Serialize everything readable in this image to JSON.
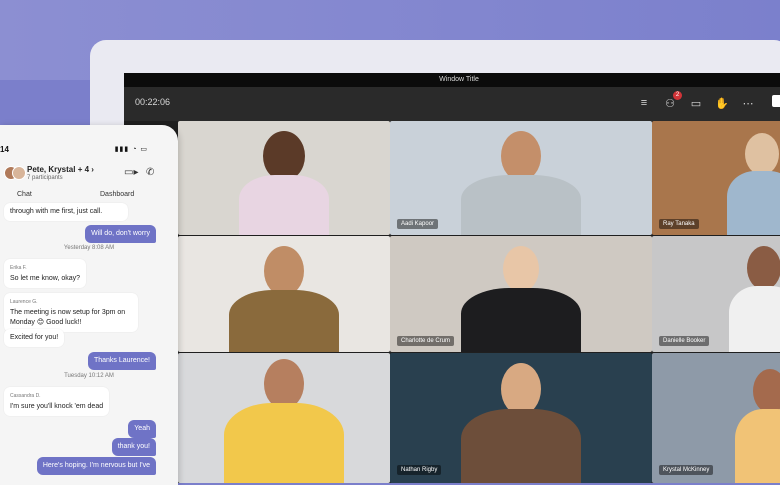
{
  "window": {
    "title": "Window Title"
  },
  "meeting": {
    "timer": "00:22:06",
    "toolbar_icons": [
      "list-icon",
      "participants-icon",
      "chat-icon",
      "raise-hand-icon",
      "more-icon"
    ],
    "participants_badge": "2",
    "tiles": [
      {
        "name": "",
        "bg": "#d9d6d0",
        "skin": "#5b3a28",
        "shirt": "#e8d5e2"
      },
      {
        "name": "Aadi Kapoor",
        "bg": "#c9d1d9",
        "skin": "#c48f6a",
        "shirt": "#b9c1c6"
      },
      {
        "name": "Ray Tanaka",
        "bg": "#a9764c",
        "skin": "#dfc1a1",
        "shirt": "#9fb7cd"
      },
      {
        "name": "",
        "bg": "#e9e6e2",
        "skin": "#c08d66",
        "shirt": "#8a6a3c"
      },
      {
        "name": "Charlotte de Crum",
        "bg": "#cfc9c2",
        "skin": "#e8c6a7",
        "shirt": "#1d1d1f"
      },
      {
        "name": "Danielle Booker",
        "bg": "#c7c7c8",
        "skin": "#8a5c44",
        "shirt": "#f0f0f0"
      },
      {
        "name": "",
        "bg": "#d8d9db",
        "skin": "#b67f5f",
        "shirt": "#f2c84b"
      },
      {
        "name": "Nathan Rigby",
        "bg": "#29404f",
        "skin": "#d8a982",
        "shirt": "#6d4e3a"
      },
      {
        "name": "Krystal McKinney",
        "bg": "#8e9aa8",
        "skin": "#a46a4d",
        "shirt": "#f1c376"
      }
    ]
  },
  "chat_panel": {
    "status_time": "14",
    "title": "Pete, Krystal + 4",
    "subtitle": "7 participants",
    "tabs": [
      "Chat",
      "Dashboard"
    ],
    "messages": [
      {
        "type": "theirs",
        "text": "through with me first, just call."
      },
      {
        "type": "mine",
        "text": "Will do, don't worry"
      },
      {
        "type": "stamp",
        "text": "Yesterday 8:08 AM"
      },
      {
        "type": "theirs",
        "sender": "Erika F.",
        "text": "So let me know, okay?"
      },
      {
        "type": "theirs",
        "sender": "Laurence G.",
        "text": "The meeting is now setup for 3pm on Monday 😊 Good luck!!"
      },
      {
        "type": "theirs",
        "text": "Excited for you!"
      },
      {
        "type": "mine",
        "text": "Thanks Laurence!"
      },
      {
        "type": "stamp",
        "text": "Tuesday 10:12 AM"
      },
      {
        "type": "theirs",
        "sender": "Cassandra D.",
        "text": "I'm sure you'll knock 'em dead"
      },
      {
        "type": "mine",
        "text": "Yeah"
      },
      {
        "type": "mine",
        "text": "thank you!"
      },
      {
        "type": "mine",
        "text": "Here's hoping. I'm nervous but I've"
      }
    ]
  }
}
